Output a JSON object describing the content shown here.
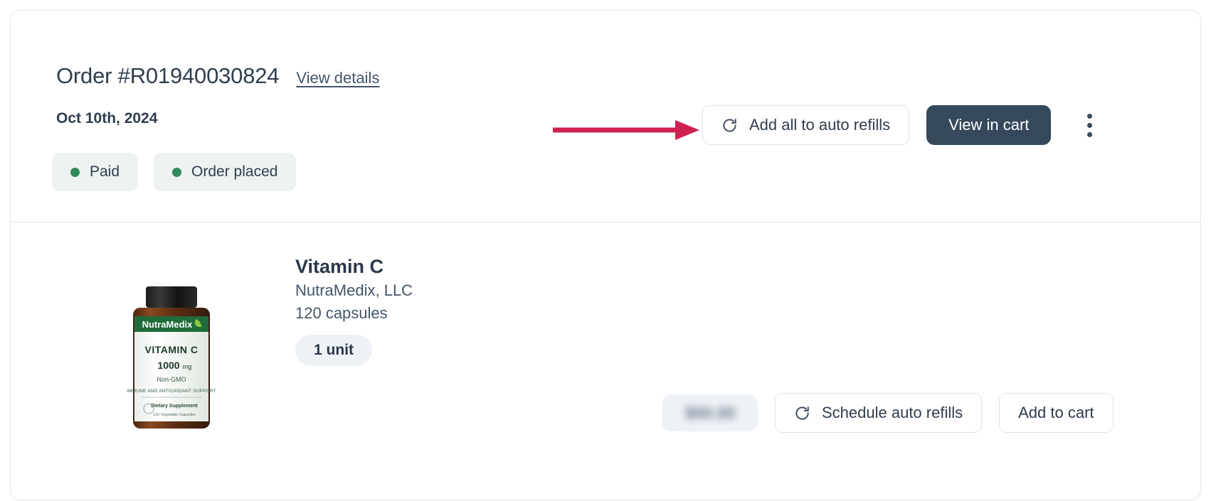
{
  "order": {
    "number": "Order #R01940030824",
    "view_details_label": "View details",
    "date": "Oct 10th, 2024",
    "badges": [
      {
        "label": "Paid",
        "dot_color": "#2f8a5b"
      },
      {
        "label": "Order placed",
        "dot_color": "#2f8a5b"
      }
    ],
    "actions": {
      "add_all_auto_refills_label": "Add all to auto refills",
      "view_in_cart_label": "View in cart",
      "overflow_menu_name": "more options"
    }
  },
  "product": {
    "name": "Vitamin C",
    "brand": "NutraMedix, LLC",
    "size": "120 capsules",
    "quantity_chip": "1 unit",
    "price_hidden": true,
    "price_placeholder": "$00.00",
    "schedule_auto_refills_label": "Schedule auto refills",
    "add_to_cart_label": "Add to cart",
    "bottle": {
      "brand_text": "NutraMedix",
      "title": "VITAMIN C",
      "dose": "1000",
      "dose_unit": "mg",
      "non_gmo": "Non-GMO",
      "claim": "IMMUNE AND ANTIOXIDANT SUPPORT",
      "supplement_label": "Dietary Supplement",
      "count_text": "120 Vegetable Capsules"
    }
  },
  "annotation": {
    "arrow_color": "#cf2050",
    "points_to": "Add all to auto refills"
  },
  "theme": {
    "card_border": "#e3e6ea",
    "text_primary": "#2f3d4f",
    "dark_button": "#36495c",
    "chip_bg": "#eef1f5",
    "badge_bg": "#eef2f0"
  }
}
